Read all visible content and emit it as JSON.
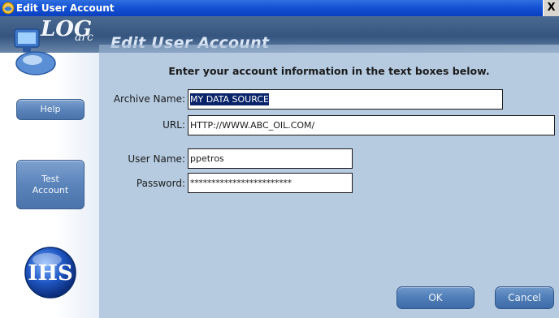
{
  "window": {
    "title": "Edit User Account",
    "close_glyph": "X"
  },
  "header": {
    "page_title": "Edit User Account",
    "logo_text": "LOGarc"
  },
  "sidebar": {
    "help_label": "Help",
    "test_label": "Test\nAccount",
    "brand_logo_text": "IHS"
  },
  "form": {
    "instruction": "Enter your account information in the text boxes below.",
    "archive_name": {
      "label": "Archive Name:",
      "value": "MY DATA SOURCE"
    },
    "url": {
      "label": "URL:",
      "value": "HTTP://WWW.ABC_OIL.COM/"
    },
    "user_name": {
      "label": "User Name:",
      "value": "ppetros"
    },
    "password": {
      "label": "Password:",
      "value": "************************"
    }
  },
  "actions": {
    "ok_label": "OK",
    "cancel_label": "Cancel"
  },
  "colors": {
    "titlebar": "#1553d4",
    "background": "#b6cbe0",
    "button": "#5b84bb"
  }
}
